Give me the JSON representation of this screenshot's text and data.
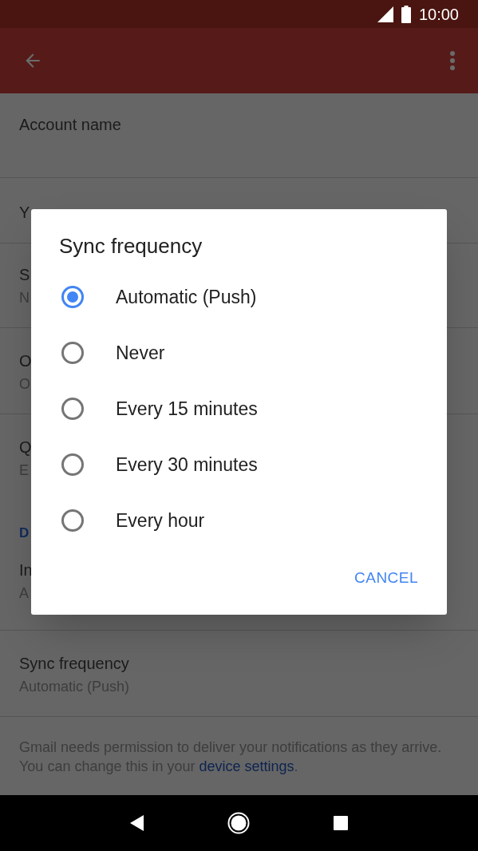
{
  "status_bar": {
    "time": "10:00"
  },
  "settings": [
    {
      "kind": "row",
      "title": "Account name"
    },
    {
      "kind": "row",
      "title": "Y"
    },
    {
      "kind": "row",
      "title": "S",
      "subtitle": "N"
    },
    {
      "kind": "row",
      "title": "O",
      "subtitle": "O"
    },
    {
      "kind": "row",
      "title": "Q",
      "subtitle": "E"
    },
    {
      "kind": "header",
      "title": "D"
    },
    {
      "kind": "row",
      "title": "In",
      "subtitle": "A"
    },
    {
      "kind": "row",
      "title": "Sync frequency",
      "subtitle": "Automatic (Push)"
    }
  ],
  "footer": {
    "text": "Gmail needs permission to deliver your notifications as they arrive. You can change this in your ",
    "link": "device settings",
    "end": "."
  },
  "dialog": {
    "title": "Sync frequency",
    "options": [
      {
        "label": "Automatic (Push)",
        "selected": true
      },
      {
        "label": "Never",
        "selected": false
      },
      {
        "label": "Every 15 minutes",
        "selected": false
      },
      {
        "label": "Every 30 minutes",
        "selected": false
      },
      {
        "label": "Every hour",
        "selected": false
      }
    ],
    "buttons": [
      "CANCEL"
    ]
  }
}
